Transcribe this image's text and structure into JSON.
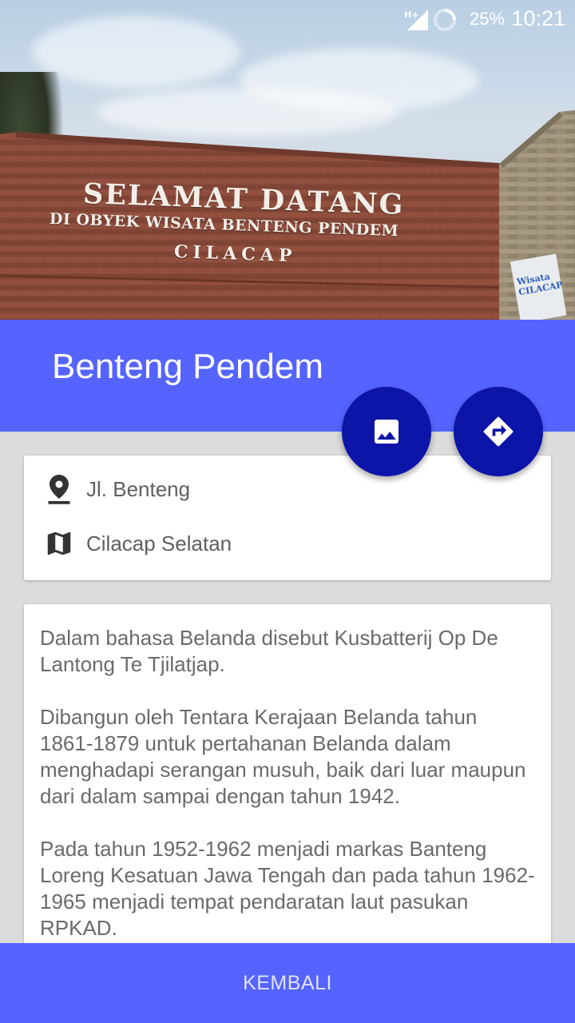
{
  "status_bar": {
    "network": "H+",
    "battery_percent": "25%",
    "time": "10:21"
  },
  "hero": {
    "sign_line1": "SELAMAT DATANG",
    "sign_line2": "DI OBYEK WISATA BENTENG PENDEM",
    "sign_line3": "CILACAP",
    "banner_text": "Wisata CILACAP"
  },
  "header": {
    "title": "Benteng Pendem"
  },
  "fabs": {
    "gallery_icon": "image-icon",
    "directions_icon": "directions-icon",
    "color": "#0d14a8"
  },
  "address": {
    "street": "Jl. Benteng",
    "street_icon": "location-pin-icon",
    "district": "Cilacap Selatan",
    "district_icon": "map-icon"
  },
  "description": {
    "paragraphs": [
      "Dalam bahasa Belanda disebut Kusbatterij Op De Lantong Te Tjilatjap.",
      "Dibangun oleh Tentara Kerajaan Belanda tahun 1861-1879 untuk pertahanan Belanda dalam menghadapi serangan musuh, baik dari luar maupun dari dalam sampai dengan tahun 1942.",
      "Pada tahun 1952-1962 menjadi markas Banteng Loreng Kesatuan Jawa Tengah dan pada tahun 1962-1965 menjadi tempat pendaratan laut pasukan RPKAD."
    ]
  },
  "footer": {
    "back_label": "KEMBALI"
  },
  "colors": {
    "primary": "#5563ff",
    "accent": "#0d14a8",
    "background": "#dcdcdc"
  }
}
